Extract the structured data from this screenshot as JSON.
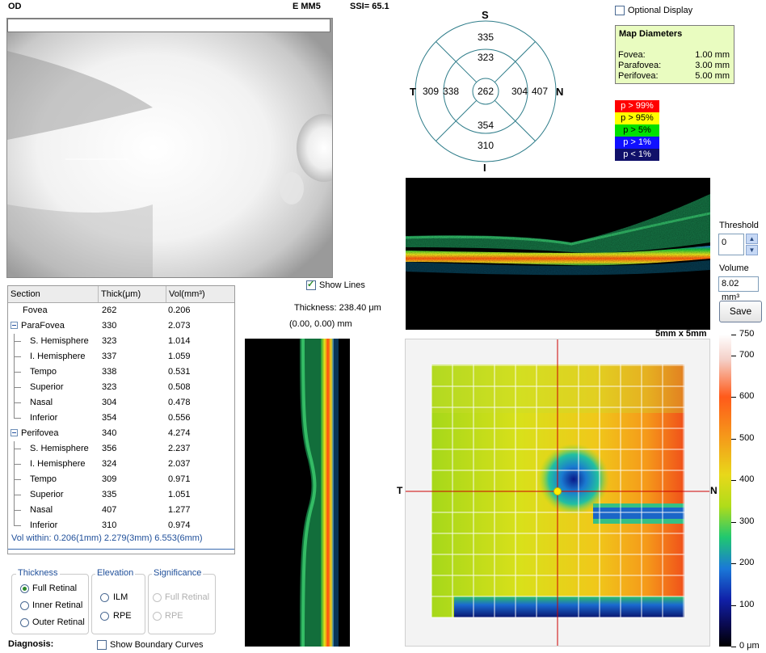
{
  "header": {
    "eye": "OD",
    "scan_mode": "E MM5",
    "ssi": "SSI= 65.1"
  },
  "etdrs": {
    "labels": {
      "s": "S",
      "i": "I",
      "t": "T",
      "n": "N"
    },
    "values": {
      "outer_s": "335",
      "inner_s": "323",
      "outer_t": "309",
      "inner_t": "338",
      "center": "262",
      "inner_n": "304",
      "outer_n": "407",
      "inner_i": "354",
      "outer_i": "310"
    }
  },
  "optional_display": {
    "label": "Optional Display",
    "checked": false
  },
  "map_diameters": {
    "title": "Map Diameters",
    "rows": [
      {
        "label": "Fovea:",
        "value": "1.00 mm"
      },
      {
        "label": "Parafovea:",
        "value": "3.00 mm"
      },
      {
        "label": "Perifovea:",
        "value": "5.00 mm"
      }
    ]
  },
  "significance_legend": [
    {
      "label": "p > 99%",
      "bg": "#ff0000",
      "fg": "#ffffff"
    },
    {
      "label": "p > 95%",
      "bg": "#ffff00",
      "fg": "#000000"
    },
    {
      "label": "p > 5%",
      "bg": "#00e000",
      "fg": "#000000"
    },
    {
      "label": "p > 1%",
      "bg": "#1010ff",
      "fg": "#ffffff"
    },
    {
      "label": "p < 1%",
      "bg": "#10106a",
      "fg": "#ffffff"
    }
  ],
  "threshold": {
    "label": "Threshold",
    "value": "0"
  },
  "volume": {
    "label": "Volume",
    "value": "8.02 mm³"
  },
  "save_label": "Save",
  "show_lines": {
    "label": "Show Lines",
    "checked": true
  },
  "thickness_readout": "Thickness: 238.40 μm",
  "coord_readout": "(0.00, 0.00) mm",
  "map_size": "5mm x 5mm",
  "map_axes": {
    "t": "T",
    "n": "N"
  },
  "scale": {
    "ticks": [
      "750",
      "700",
      "600",
      "500",
      "400",
      "300",
      "200",
      "100",
      "0 μm"
    ]
  },
  "table": {
    "headers": [
      "Section",
      "Thick(μm)",
      "Vol(mm³)"
    ],
    "rows": [
      {
        "section": "Fovea",
        "thick": "262",
        "vol": "0.206"
      },
      {
        "section": "ParaFovea",
        "thick": "330",
        "vol": "2.073"
      },
      {
        "section": "S. Hemisphere",
        "thick": "323",
        "vol": "1.014"
      },
      {
        "section": "I. Hemisphere",
        "thick": "337",
        "vol": "1.059"
      },
      {
        "section": "Tempo",
        "thick": "338",
        "vol": "0.531"
      },
      {
        "section": "Superior",
        "thick": "323",
        "vol": "0.508"
      },
      {
        "section": "Nasal",
        "thick": "304",
        "vol": "0.478"
      },
      {
        "section": "Inferior",
        "thick": "354",
        "vol": "0.556"
      },
      {
        "section": "Perifovea",
        "thick": "340",
        "vol": "4.274"
      },
      {
        "section": "S. Hemisphere",
        "thick": "356",
        "vol": "2.237"
      },
      {
        "section": "I. Hemisphere",
        "thick": "324",
        "vol": "2.037"
      },
      {
        "section": "Tempo",
        "thick": "309",
        "vol": "0.971"
      },
      {
        "section": "Superior",
        "thick": "335",
        "vol": "1.051"
      },
      {
        "section": "Nasal",
        "thick": "407",
        "vol": "1.277"
      },
      {
        "section": "Inferior",
        "thick": "310",
        "vol": "0.974"
      }
    ],
    "vol_within": "Vol within: 0.206(1mm) 2.279(3mm) 6.553(6mm)"
  },
  "thickness_group": {
    "title": "Thickness",
    "options": [
      "Full Retinal",
      "Inner Retinal",
      "Outer Retinal"
    ],
    "selected": "Full Retinal"
  },
  "elevation_group": {
    "title": "Elevation",
    "options": [
      "ILM",
      "RPE"
    ]
  },
  "significance_group": {
    "title": "Significance",
    "options": [
      "Full Retinal",
      "RPE"
    ]
  },
  "diagnosis_label": "Diagnosis:",
  "show_boundary": {
    "label": "Show Boundary Curves",
    "checked": false
  }
}
